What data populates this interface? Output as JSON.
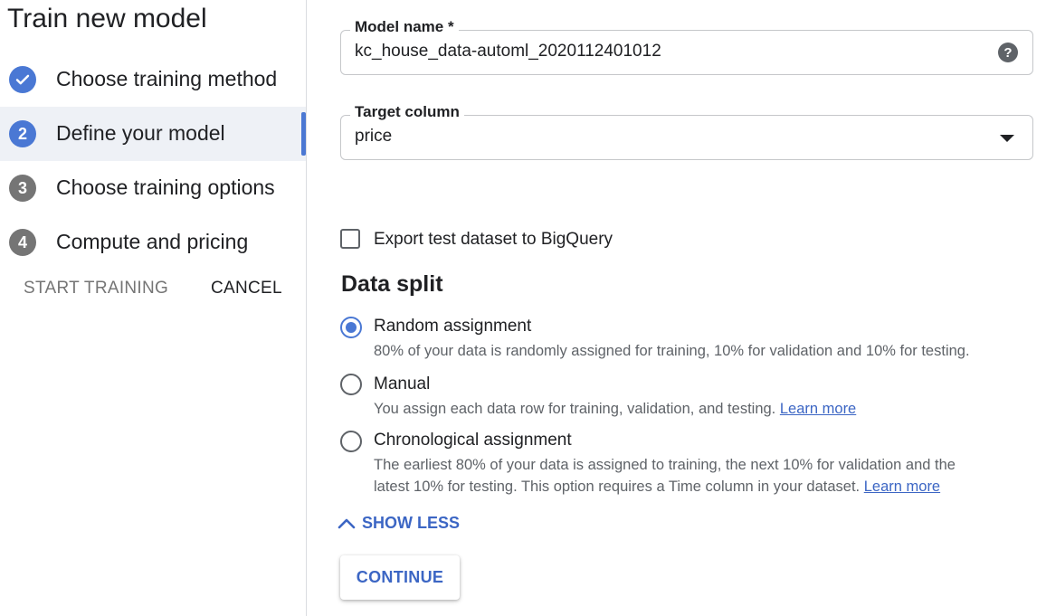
{
  "sidebar": {
    "title": "Train new model",
    "steps": [
      {
        "number": "",
        "label": "Choose training method",
        "state": "done",
        "icon": "check-icon"
      },
      {
        "number": "2",
        "label": "Define your model",
        "state": "current"
      },
      {
        "number": "3",
        "label": "Choose training options",
        "state": "pending"
      },
      {
        "number": "4",
        "label": "Compute and pricing",
        "state": "pending"
      }
    ],
    "start_training_label": "START TRAINING",
    "cancel_label": "CANCEL"
  },
  "form": {
    "model_name": {
      "label": "Model name *",
      "value": "kc_house_data-automl_2020112401012",
      "help_icon": "help-icon"
    },
    "target_column": {
      "label": "Target column",
      "value": "price",
      "dropdown_icon": "arrow-drop-down-icon"
    },
    "export_checkbox": {
      "label": "Export test dataset to BigQuery",
      "checked": false
    },
    "data_split": {
      "title": "Data split",
      "options": [
        {
          "label": "Random assignment",
          "selected": true,
          "description": "80% of your data is randomly assigned for training, 10% for validation and 10% for testing."
        },
        {
          "label": "Manual",
          "selected": false,
          "description": "You assign each data row for training, validation, and testing.",
          "link": "Learn more"
        },
        {
          "label": "Chronological assignment",
          "selected": false,
          "description_line1": "The earliest 80% of your data is assigned to training, the next 10% for validation and the",
          "description_line2": "latest 10% for testing. This option requires a Time column in your dataset.",
          "link": "Learn more"
        }
      ]
    },
    "show_less_label": "SHOW LESS",
    "continue_label": "CONTINUE"
  },
  "colors": {
    "accent": "#4a78d4",
    "link": "#3c66c4",
    "pending_step": "#757575",
    "active_bg": "#eef1f6"
  }
}
